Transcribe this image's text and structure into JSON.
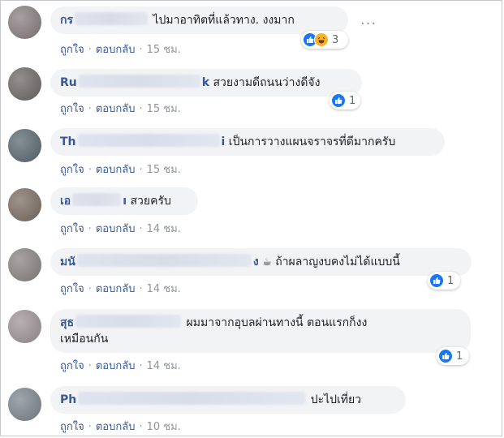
{
  "actions": {
    "like": "ถูกใจ",
    "reply": "ตอบกลับ",
    "separator": "·"
  },
  "comments": [
    {
      "name_visible": "กร",
      "text": "ไปมาอาทิตที่แล้วทาง. งงมาก",
      "time": "15 ชม.",
      "reactions": "3",
      "avatar_color": "#8a7f82"
    },
    {
      "name_visible": "Ru",
      "name_suffix": "k",
      "text": "สวยงามดีถนนว่างดีจัง",
      "time": "15 ชม.",
      "reactions": "1",
      "avatar_color": "#6f6a6a"
    },
    {
      "name_visible": "Th",
      "name_suffix": "i",
      "text": "เป็นการวางแผนจราจรที่ดีมากครับ",
      "time": "15 ชม.",
      "reactions": "",
      "avatar_color": "#5d6a73"
    },
    {
      "name_visible": "เอ",
      "name_suffix": "ı",
      "text": "สวยครับ",
      "time": "14 ชม.",
      "reactions": "",
      "avatar_color": "#7d7066"
    },
    {
      "name_visible": "มนั",
      "name_suffix": "ง",
      "text": "ถ้าผลาญงบคงไม่ได้แบบนี้",
      "emoji": "☕",
      "time": "14 ชม.",
      "reactions": "1",
      "avatar_color": "#8c8585"
    },
    {
      "name_visible": "สุธ",
      "text_line1": "ผมมาจากอุบลผ่านทางนี้ ตอนแรกก็งง",
      "text_line2": "เหมือนกัน",
      "time": "14 ชม.",
      "reactions": "1",
      "avatar_color": "#a0969a"
    },
    {
      "name_visible": "Ph",
      "text": "ปะไปเที่ยว",
      "time": "10 ชม.",
      "reactions": "",
      "avatar_color": "#7f8890"
    }
  ],
  "icons": {
    "like": "thumbs-up-icon",
    "haha": "laughing-face-icon",
    "more": "more-options-icon"
  }
}
